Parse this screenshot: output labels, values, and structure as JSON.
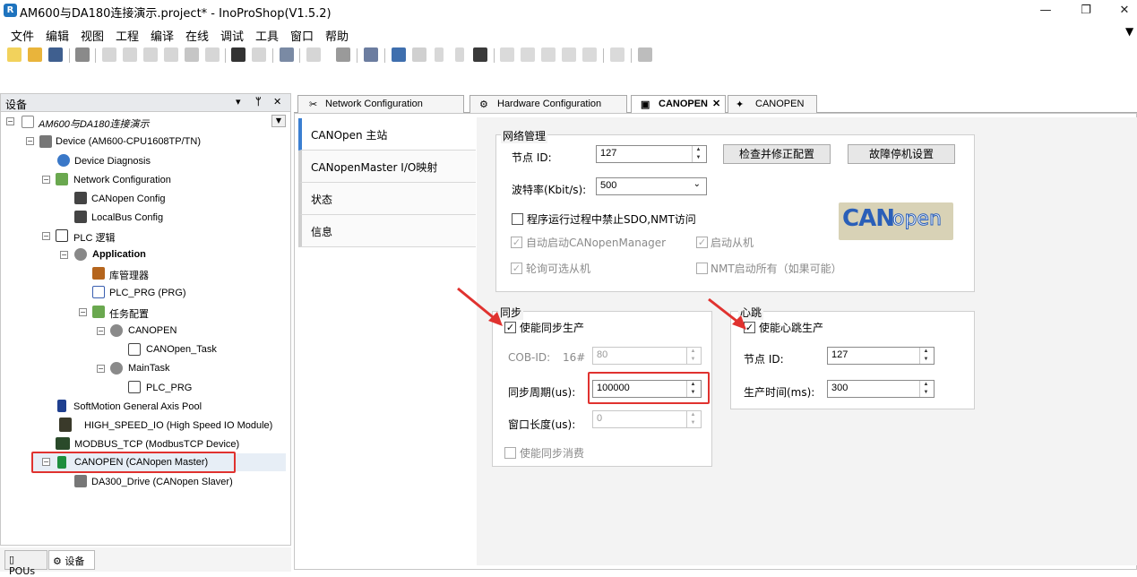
{
  "window": {
    "title": "AM600与DA180连接演示.project* - InoProShop(V1.5.2)",
    "app_icon": "R",
    "controls": [
      "—",
      "❐",
      "✕"
    ]
  },
  "menu": [
    "文件",
    "编辑",
    "视图",
    "工程",
    "编译",
    "在线",
    "调试",
    "工具",
    "窗口",
    "帮助"
  ],
  "devices_panel": {
    "title": "设备",
    "controls": [
      "▾",
      "ᛘ",
      "✕"
    ],
    "tree": [
      {
        "label": "AM600与DA180连接演示",
        "italic": true
      },
      {
        "label": "Device (AM600-CPU1608TP/TN)"
      },
      {
        "label": "Device Diagnosis"
      },
      {
        "label": "Network Configuration"
      },
      {
        "label": "CANopen Config"
      },
      {
        "label": "LocalBus Config"
      },
      {
        "label": "PLC 逻辑"
      },
      {
        "label": "Application",
        "bold": true
      },
      {
        "label": "库管理器"
      },
      {
        "label": "PLC_PRG (PRG)"
      },
      {
        "label": "任务配置"
      },
      {
        "label": "CANOPEN"
      },
      {
        "label": "CANOpen_Task"
      },
      {
        "label": "MainTask"
      },
      {
        "label": "PLC_PRG"
      },
      {
        "label": "SoftMotion General Axis Pool"
      },
      {
        "label": "HIGH_SPEED_IO (High Speed IO Module)"
      },
      {
        "label": "MODBUS_TCP (ModbusTCP Device)"
      },
      {
        "label": "CANOPEN (CANopen Master)"
      },
      {
        "label": "DA300_Drive (CANopen Slaver)"
      }
    ],
    "bottom_tabs": [
      "POUs",
      "设备"
    ]
  },
  "doc_tabs": [
    {
      "label": "Network Configuration"
    },
    {
      "label": "Hardware Configuration"
    },
    {
      "label": "CANOPEN",
      "active": true,
      "close": "✕"
    },
    {
      "label": "CANOPEN"
    }
  ],
  "side_tabs": [
    "CANOpen 主站",
    "CANopenMaster I/O映射",
    "状态",
    "信息"
  ],
  "network_mgmt": {
    "title": "网络管理",
    "node_id_label": "节点 ID:",
    "node_id_value": "127",
    "check_fix_button": "检查并修正配置",
    "fault_stop_button": "故障停机设置",
    "baud_label": "波特率(Kbit/s):",
    "baud_value": "500",
    "disable_sdo_label": "程序运行过程中禁止SDO,NMT访问",
    "auto_start_label": "自动启动CANopenManager",
    "start_slaves_label": "启动从机",
    "poll_optional_label": "轮询可选从机",
    "nmt_start_all_label": "NMT启动所有（如果可能）",
    "logo_text_can": "CAN",
    "logo_text_open": "open"
  },
  "sync": {
    "title": "同步",
    "enable_label": "使能同步生产",
    "cobid_label": "COB-ID:",
    "cobid_prefix": "16#",
    "cobid_value": "80",
    "period_label": "同步周期(us):",
    "period_value": "100000",
    "window_label": "窗口长度(us):",
    "window_value": "0",
    "consume_label": "使能同步消费"
  },
  "heartbeat": {
    "title": "心跳",
    "enable_label": "使能心跳生产",
    "node_id_label": "节点 ID:",
    "node_id_value": "127",
    "time_label": "生产时间(ms):",
    "time_value": "300"
  },
  "colors": {
    "accent_red": "#e0322f",
    "tab_accent": "#3b7fd1"
  }
}
